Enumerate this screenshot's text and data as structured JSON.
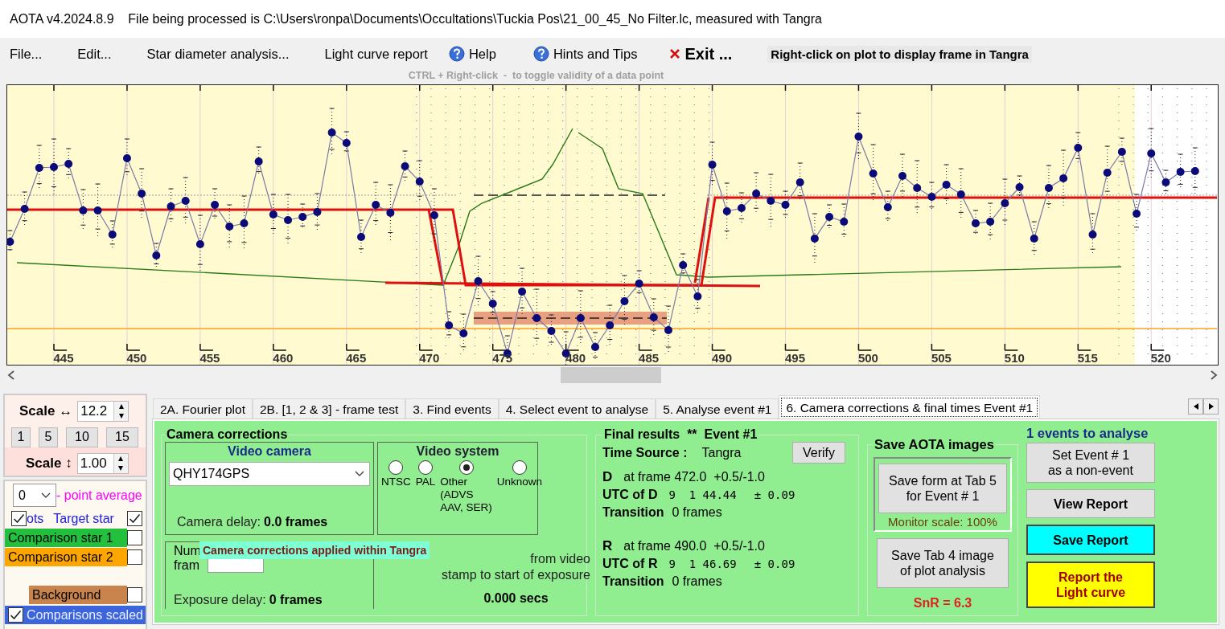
{
  "window": {
    "title": "AOTA v4.2024.8.9    File being processed is C:\\Users\\ronpa\\Documents\\Occultations\\Tuckia Pos\\21_00_45_No Filter.lc, measured with Tangra"
  },
  "menu": [
    {
      "label": "File...",
      "kind": "plain"
    },
    {
      "label": "Edit...",
      "kind": "plain"
    },
    {
      "label": "Star diameter analysis...",
      "kind": "plain"
    },
    {
      "label": "Light curve report",
      "kind": "plain"
    },
    {
      "label": "Help",
      "kind": "help"
    },
    {
      "label": "Hints and Tips",
      "kind": "help"
    },
    {
      "label": "Exit ...",
      "kind": "exit"
    }
  ],
  "right_click_hint": "Right-click on plot to display frame in Tangra",
  "ctrl_hint": "CTRL + Right-click  -  to toggle validity of a data point",
  "plot": {
    "x_tick_labels": [
      "445",
      "450",
      "455",
      "460",
      "465",
      "470",
      "475",
      "480",
      "485",
      "490",
      "495",
      "500",
      "505",
      "510",
      "515",
      "520"
    ]
  },
  "scale": {
    "horizontal": {
      "label": "Scale",
      "arrow": "↔",
      "value": "12.2"
    },
    "presets": [
      "1",
      "5",
      "10",
      "15"
    ],
    "vertical": {
      "label": "Scale",
      "arrow": "↕",
      "value": "1.00"
    }
  },
  "series_panel": {
    "average": {
      "value": "0",
      "label": "- point average"
    },
    "plots": {
      "label": "ots",
      "checked": true
    },
    "series": [
      {
        "label": "Target star",
        "kind": "text",
        "color": "#2020e0",
        "checked": true
      },
      {
        "label": "Comparison star 1",
        "kind": "band",
        "color": "#22c03c",
        "checked": false
      },
      {
        "label": "Comparison star 2",
        "kind": "band",
        "color": "#ffa500",
        "checked": false
      },
      {
        "label": "Background",
        "kind": "tag",
        "color": "#c8844c",
        "checked": false
      },
      {
        "label": "Comparisons scaled",
        "kind": "scaled",
        "color": "#3c64dc",
        "checked": true
      }
    ]
  },
  "tabs": [
    {
      "label": "2A. Fourier plot",
      "selected": false
    },
    {
      "label": "2B. [1, 2 & 3] - frame test",
      "selected": false
    },
    {
      "label": "3. Find events",
      "selected": false
    },
    {
      "label": "4. Select event to analyse",
      "selected": false
    },
    {
      "label": "5. Analyse event #1",
      "selected": false
    },
    {
      "label": "6. Camera corrections & final times Event #1",
      "selected": true
    }
  ],
  "camera_corrections": {
    "title": "Camera corrections",
    "video_camera": {
      "title": "Video camera",
      "camera": "QHY174GPS",
      "delay_label": "Camera delay:",
      "delay_value": "0.0 frames"
    },
    "video_system": {
      "title": "Video system",
      "options": [
        {
          "lines": [
            "NTSC"
          ],
          "selected": false
        },
        {
          "lines": [
            "PAL"
          ],
          "selected": false
        },
        {
          "lines": [
            "Other",
            "(ADVS",
            "AAV, SER)"
          ],
          "selected": true
        },
        {
          "lines": [
            "Unknown"
          ],
          "selected": false
        }
      ]
    },
    "frames_integrated": {
      "lines": [
        "Num",
        "fram"
      ],
      "exposure_label": "Exposure delay:",
      "exposure_value": "0 frames"
    },
    "stamp_note": {
      "lines": [
        "from video",
        "stamp to start of exposure"
      ],
      "value": "0.000 secs"
    },
    "tooltip": "Camera corrections applied within Tangra"
  },
  "final_results": {
    "title": "Final results  **  Event #1",
    "time_source_label": "Time Source :",
    "time_source": "Tangra",
    "verify": "Verify",
    "events": [
      {
        "letter": "D",
        "frame": "at frame 472.0  +0.5/-1.0",
        "utc_label": "UTC of D",
        "utc": "9  1 44.44",
        "error": "± 0.09",
        "transition_label": "Transition",
        "transition": "0 frames"
      },
      {
        "letter": "R",
        "frame": "at frame 490.0  +0.5/-1.0",
        "utc_label": "UTC of R",
        "utc": "9  1 46.69",
        "error": "± 0.09",
        "transition_label": "Transition",
        "transition": "0 frames"
      }
    ]
  },
  "save_images": {
    "title": "Save AOTA images",
    "save_form": [
      "Save form at Tab 5",
      "for Event # 1"
    ],
    "monitor_scale": "Monitor scale: 100%",
    "save_tab4": [
      "Save Tab 4 image",
      "of plot analysis"
    ],
    "snr": "SnR = 6.3"
  },
  "actions": {
    "heading": "1 events to analyse",
    "buttons": [
      {
        "lines": [
          "Set Event # 1",
          "as a non-event"
        ],
        "kind": "plain"
      },
      {
        "lines": [
          "View Report"
        ],
        "kind": "bold"
      },
      {
        "lines": [
          "Save Report"
        ],
        "kind": "save"
      },
      {
        "lines": [
          "Report the",
          "Light curve"
        ],
        "kind": "report"
      }
    ]
  }
}
